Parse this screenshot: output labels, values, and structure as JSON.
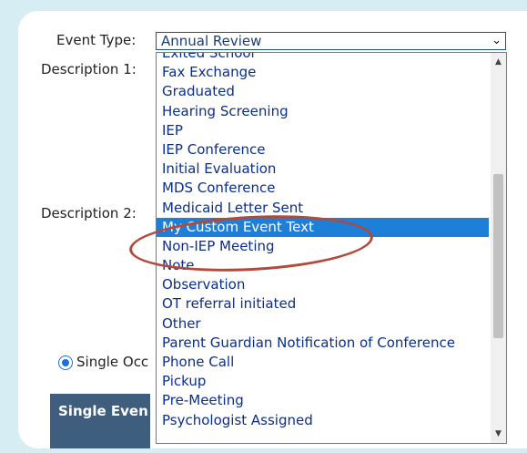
{
  "form": {
    "event_type_label": "Event Type:",
    "description1_label": "Description 1:",
    "description2_label": "Description 2:",
    "selected_value": "Annual Review",
    "radio_label": "Single Occ",
    "section_header": "Single Even"
  },
  "dropdown": {
    "options": [
      "Exited School",
      "Fax Exchange",
      "Graduated",
      "Hearing Screening",
      "IEP",
      "IEP Conference",
      "Initial Evaluation",
      "MDS Conference",
      "Medicaid Letter Sent",
      "My Custom Event Text",
      "Non-IEP Meeting",
      "Note",
      "Observation",
      "OT referral initiated",
      "Other",
      "Parent Guardian Notification of Conference",
      "Phone Call",
      "Pickup",
      "Pre-Meeting",
      "Psychologist Assigned"
    ],
    "highlighted": "My Custom Event Text"
  },
  "icons": {
    "select_arrow": "chevron-down-icon",
    "scroll_up": "scroll-up-icon",
    "scroll_down": "scroll-down-icon"
  },
  "colors": {
    "highlight": "#1e7fd8",
    "annotation": "#b3493a",
    "header": "#3f5d7d"
  }
}
